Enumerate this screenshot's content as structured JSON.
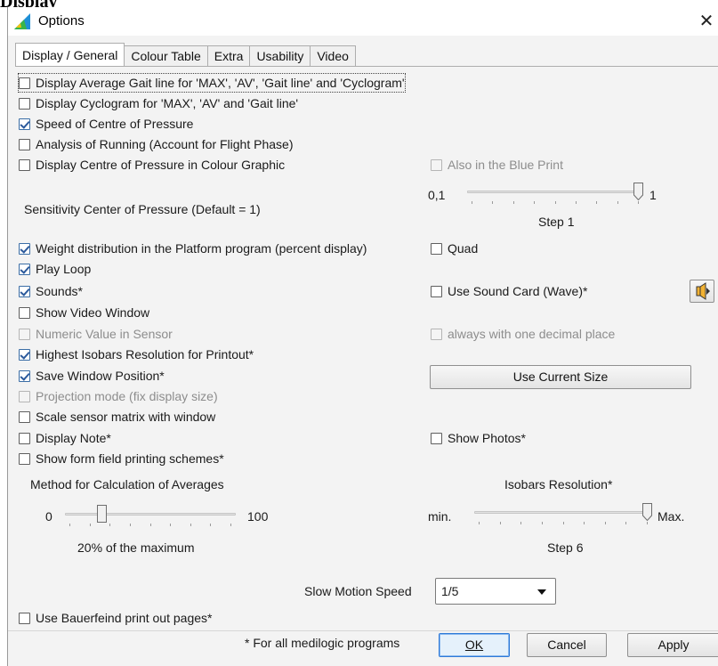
{
  "page_heading": "Display",
  "window": {
    "title": "Options",
    "close_glyph": "✕"
  },
  "tabs": [
    {
      "label": "Display / General",
      "active": true
    },
    {
      "label": "Colour Table",
      "active": false
    },
    {
      "label": "Extra",
      "active": false
    },
    {
      "label": "Usability",
      "active": false
    },
    {
      "label": "Video",
      "active": false
    }
  ],
  "checkboxes": {
    "avg_gait_line": {
      "label": "Display Average Gait line for 'MAX', 'AV', 'Gait line' and 'Cyclogram'",
      "checked": false
    },
    "cyclogram": {
      "label": "Display Cyclogram  for 'MAX', 'AV' and 'Gait line'",
      "checked": false
    },
    "speed_cop": {
      "label": "Speed of Centre of Pressure",
      "checked": true
    },
    "running": {
      "label": "Analysis of Running (Account for Flight Phase)",
      "checked": false
    },
    "cop_colour": {
      "label": "Display Centre of Pressure in Colour Graphic",
      "checked": false
    },
    "blue_print": {
      "label": "Also in the Blue Print",
      "checked": false
    },
    "weight_distribution": {
      "label": "Weight distribution in the Platform program (percent display)",
      "checked": true
    },
    "quad": {
      "label": "Quad",
      "checked": false
    },
    "play_loop": {
      "label": "Play Loop",
      "checked": true
    },
    "sounds": {
      "label": "Sounds*",
      "checked": true
    },
    "sound_card": {
      "label": "Use Sound Card (Wave)*",
      "checked": false
    },
    "video_window": {
      "label": "Show Video Window",
      "checked": false
    },
    "numeric_value": {
      "label": "Numeric Value in Sensor",
      "checked": false
    },
    "one_decimal": {
      "label": "always with one decimal place",
      "checked": false
    },
    "isobars_printout": {
      "label": "Highest Isobars Resolution for Printout*",
      "checked": true
    },
    "save_window": {
      "label": "Save Window Position*",
      "checked": true
    },
    "projection_mode": {
      "label": "Projection mode (fix display size)",
      "checked": false
    },
    "scale_matrix": {
      "label": "Scale sensor matrix with window",
      "checked": false
    },
    "display_note": {
      "label": "Display Note*",
      "checked": false
    },
    "show_photos": {
      "label": "Show Photos*",
      "checked": false
    },
    "form_field": {
      "label": "Show form field printing schemes*",
      "checked": false
    },
    "bauerfeind": {
      "label": "Use Bauerfeind print out pages*",
      "checked": false
    }
  },
  "cop_sensitivity": {
    "label": "Sensitivity Center of Pressure (Default = 1)",
    "min_label": "0,1",
    "max_label": "1",
    "step_label": "Step 1",
    "level": 1.0
  },
  "use_current_size_button": "Use Current Size",
  "averages": {
    "title": "Method for Calculation of Averages",
    "min_label": "0",
    "max_label": "100",
    "caption": "20% of the maximum",
    "level": 0.2
  },
  "isobars": {
    "title": "Isobars Resolution*",
    "min_label": "min.",
    "max_label": "Max.",
    "step_label": "Step 6",
    "level": 1.0
  },
  "slow_motion": {
    "label": "Slow Motion Speed",
    "value": "1/5"
  },
  "footer": {
    "note": "* For all medilogic programs",
    "ok": "OK",
    "cancel": "Cancel",
    "apply": "Apply"
  }
}
